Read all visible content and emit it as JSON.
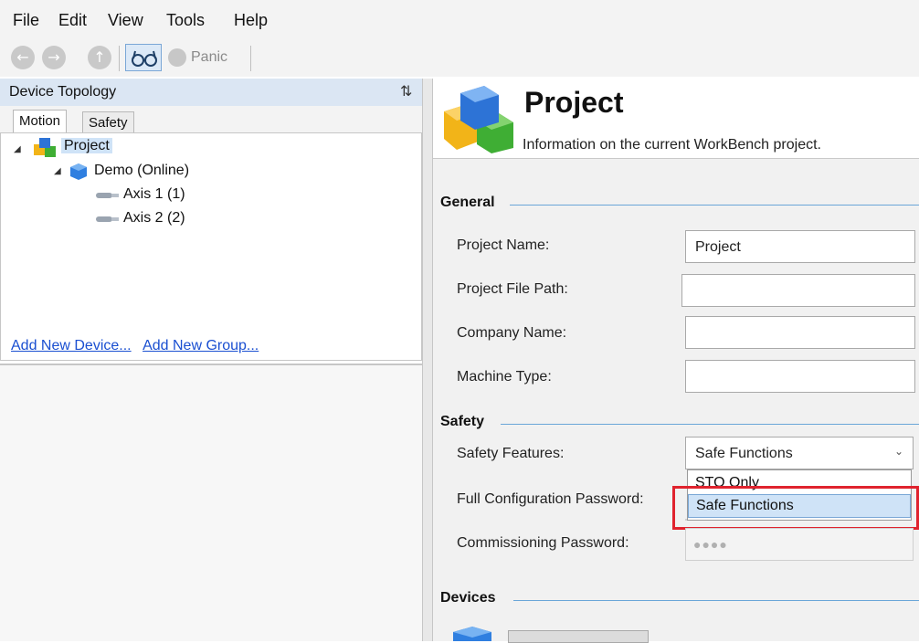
{
  "menu": [
    "File",
    "Edit",
    "View",
    "Tools",
    "Help"
  ],
  "toolbar": {
    "back_icon": "left-arrow-circle",
    "forward_icon": "right-arrow-circle",
    "up_icon": "up-arrow-circle",
    "glasses_icon": "glasses",
    "panic_label": "Panic"
  },
  "left_panel": {
    "title": "Device Topology",
    "pin": "📌",
    "tabs": [
      "Motion",
      "Safety"
    ],
    "tree": {
      "project": "Project",
      "device": "Demo (Online)",
      "axes": [
        "Axis 1 (1)",
        "Axis 2 (2)"
      ]
    },
    "links": [
      "Add New Device...",
      "Add New Group..."
    ]
  },
  "project_header": {
    "title": "Project",
    "subtitle": "Information on the current WorkBench project."
  },
  "sections": {
    "general": "General",
    "safety": "Safety",
    "devices": "Devices"
  },
  "fields": {
    "project_name_label": "Project Name:",
    "project_name_value": "Project",
    "file_path_label": "Project File Path:",
    "company_label": "Company Name:",
    "machine_label": "Machine Type:",
    "safety_features_label": "Safety Features:",
    "safety_features_value": "Safe Functions",
    "full_pw_label": "Full Configuration Password:",
    "commissioning_pw_label": "Commissioning Password:",
    "pw_mask": "●●●●"
  },
  "dropdown": {
    "options": [
      "STO Only",
      "Safe Functions"
    ]
  },
  "colors": {
    "accent": "#6aa6d8",
    "highlight": "#e0232e",
    "selection": "#cfe3f7"
  }
}
